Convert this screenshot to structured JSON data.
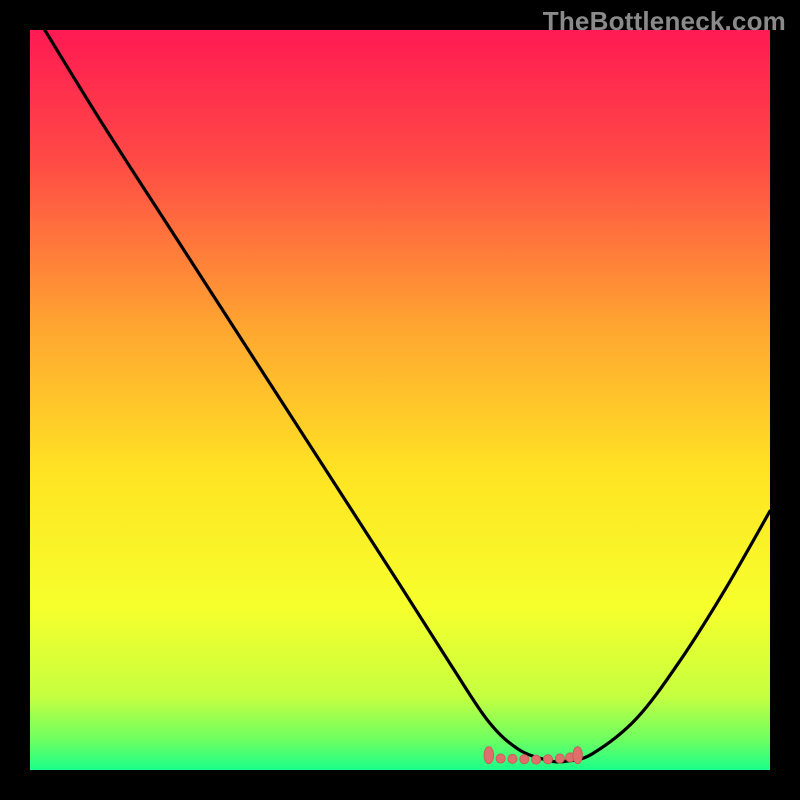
{
  "watermark": "TheBottleneck.com",
  "colors": {
    "bg": "#000000",
    "curve": "#000000",
    "marker_fill": "#de6f6b",
    "marker_stroke": "#c45a56"
  },
  "chart_data": {
    "type": "line",
    "title": "",
    "xlabel": "",
    "ylabel": "",
    "xlim": [
      0,
      100
    ],
    "ylim": [
      0,
      100
    ],
    "gradient_stops": [
      {
        "offset": 0.0,
        "color": "#ff1a53"
      },
      {
        "offset": 0.18,
        "color": "#ff4b45"
      },
      {
        "offset": 0.4,
        "color": "#ffa531"
      },
      {
        "offset": 0.6,
        "color": "#ffe423"
      },
      {
        "offset": 0.78,
        "color": "#f6ff2c"
      },
      {
        "offset": 0.9,
        "color": "#c6ff3f"
      },
      {
        "offset": 0.96,
        "color": "#6cff62"
      },
      {
        "offset": 1.0,
        "color": "#1aff89"
      }
    ],
    "series": [
      {
        "name": "bottleneck-curve",
        "x": [
          2.0,
          10.0,
          20.0,
          30.0,
          40.0,
          50.0,
          57.0,
          62.0,
          66.0,
          70.0,
          72.5,
          76.0,
          82.0,
          88.0,
          94.0,
          100.0
        ],
        "y": [
          100.0,
          87.0,
          71.5,
          56.0,
          40.5,
          25.0,
          14.0,
          6.5,
          2.8,
          1.3,
          1.2,
          2.2,
          7.0,
          15.0,
          24.5,
          35.0
        ]
      }
    ],
    "flat_region": {
      "x_start": 62.0,
      "x_end": 74.0,
      "y": 1.6,
      "endpoints": [
        {
          "x": 62.0,
          "y": 2.0
        },
        {
          "x": 74.0,
          "y": 2.0
        }
      ],
      "dots": [
        {
          "x": 63.6,
          "y": 1.55
        },
        {
          "x": 65.2,
          "y": 1.5
        },
        {
          "x": 66.8,
          "y": 1.45
        },
        {
          "x": 68.4,
          "y": 1.4
        },
        {
          "x": 70.0,
          "y": 1.45
        },
        {
          "x": 71.6,
          "y": 1.55
        },
        {
          "x": 73.0,
          "y": 1.7
        }
      ]
    }
  }
}
